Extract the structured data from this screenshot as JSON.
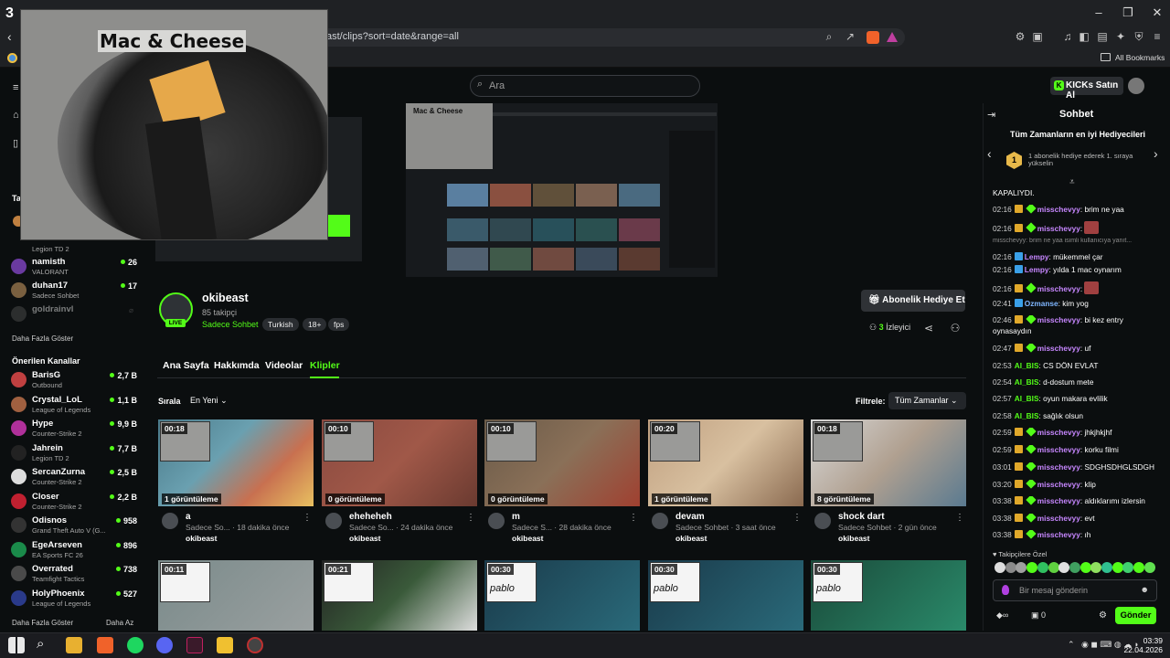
{
  "browser": {
    "url": "ast/clips?sort=date&range=all",
    "all_bookmarks": "All Bookmarks",
    "tab_number": "3"
  },
  "pip": {
    "title": "Mac & Cheese"
  },
  "header": {
    "search_placeholder": "Ara",
    "buy_kicks": "KICKs Satın Al"
  },
  "sidebar": {
    "partial_cat": "Legion TD 2",
    "channels": [
      {
        "name": "namisth",
        "category": "VALORANT",
        "viewers": "26"
      },
      {
        "name": "duhan17",
        "category": "Sadece Sohbet",
        "viewers": "17"
      },
      {
        "name": "goldrainvl",
        "category": "",
        "viewers": ""
      }
    ],
    "show_more_1": "Daha Fazla Göster",
    "recommended_title": "Önerilen Kanallar",
    "recommended": [
      {
        "name": "BarisG",
        "category": "Outbound",
        "viewers": "2,7 B"
      },
      {
        "name": "Crystal_LoL",
        "category": "League of Legends",
        "viewers": "1,1 B"
      },
      {
        "name": "Hype",
        "category": "Counter-Strike 2",
        "viewers": "9,9 B"
      },
      {
        "name": "Jahrein",
        "category": "Legion TD 2",
        "viewers": "7,7 B"
      },
      {
        "name": "SercanZurna",
        "category": "Counter-Strike 2",
        "viewers": "2,5 B"
      },
      {
        "name": "Closer",
        "category": "Counter-Strike 2",
        "viewers": "2,2 B"
      },
      {
        "name": "Odisnos",
        "category": "Grand Theft Auto V (G...",
        "viewers": "958"
      },
      {
        "name": "EgeArseven",
        "category": "EA Sports FC 26",
        "viewers": "896"
      },
      {
        "name": "Overrated",
        "category": "Teamfight Tactics",
        "viewers": "738"
      },
      {
        "name": "HolyPhoenix",
        "category": "League of Legends",
        "viewers": "527"
      }
    ],
    "show_more_2": "Daha Fazla Göster",
    "show_less": "Daha Az"
  },
  "channel": {
    "name": "okibeast",
    "followers": "85 takipçi",
    "category": "Sadece Sohbet",
    "tags": [
      "Turkish",
      "18+",
      "fps"
    ],
    "live": "LIVE",
    "gift_sub": "Abonelik Hediye Et",
    "viewer_count": "3",
    "viewer_label": "İzleyici"
  },
  "tabs": [
    "Ana Sayfa",
    "Hakkımda",
    "Videolar",
    "Klipler"
  ],
  "sort": {
    "label": "Sırala",
    "value": "En Yeni"
  },
  "filter": {
    "label": "Filtrele:",
    "value": "Tüm Zamanlar"
  },
  "clips": [
    {
      "duration": "00:18",
      "views": "1 görüntüleme",
      "title": "a",
      "meta": "Sadece So... · 18 dakika önce",
      "channel": "okibeast"
    },
    {
      "duration": "00:10",
      "views": "0 görüntüleme",
      "title": "eheheheh",
      "meta": "Sadece So... · 24 dakika önce",
      "channel": "okibeast"
    },
    {
      "duration": "00:10",
      "views": "0 görüntüleme",
      "title": "m",
      "meta": "Sadece S... · 28 dakika önce",
      "channel": "okibeast"
    },
    {
      "duration": "00:20",
      "views": "1 görüntüleme",
      "title": "devam",
      "meta": "Sadece Sohbet · 3 saat önce",
      "channel": "okibeast"
    },
    {
      "duration": "00:18",
      "views": "8 görüntüleme",
      "title": "shock dart",
      "meta": "Sadece Sohbet · 2 gün önce",
      "channel": "okibeast"
    }
  ],
  "clips_row2": [
    {
      "duration": "00:11",
      "caption": ""
    },
    {
      "duration": "00:21",
      "caption": ""
    },
    {
      "duration": "00:30",
      "caption": "pablo"
    },
    {
      "duration": "00:30",
      "caption": "pablo"
    },
    {
      "duration": "00:30",
      "caption": "pablo"
    }
  ],
  "chat": {
    "title": "Sohbet",
    "top_gifters": "Tüm Zamanların en iyi Hediyecileri",
    "gift_rank": "1",
    "gift_text": "1 abonelik hediye ederek 1. sıraya yükselin",
    "closed": "KAPALIYDI.",
    "reply_preview": "misschevyy: brim ne yaa isimli kullanıcıya yanıt...",
    "messages": [
      {
        "time": "02:16",
        "user": "misschevyy",
        "text": "brim ne yaa",
        "badges": "sub-gift",
        "color": "#c787ff"
      },
      {
        "time": "02:16",
        "user": "misschevyy",
        "text": "",
        "badges": "sub-gift",
        "color": "#c787ff",
        "emote": true
      },
      {
        "time": "02:16",
        "user": "Lempy",
        "text": "mükemmel çar",
        "badges": "blue",
        "color": "#c787ff"
      },
      {
        "time": "02:16",
        "user": "Lempy",
        "text": "yılda 1 mac oynarım",
        "badges": "blue",
        "color": "#c787ff"
      },
      {
        "time": "02:16",
        "user": "misschevyy",
        "text": "",
        "badges": "sub-gift",
        "color": "#c787ff",
        "emote": true
      },
      {
        "time": "02:41",
        "user": "Ozmanse",
        "text": "kim yog",
        "badges": "blue",
        "color": "#7fb6ff"
      },
      {
        "time": "02:46",
        "user": "misschevyy",
        "text": "bi kez entry",
        "badges": "sub-gift",
        "color": "#c787ff"
      },
      {
        "time": "02:47",
        "user": "misschevyy",
        "text": "uf",
        "badges": "sub-gift",
        "color": "#c787ff"
      },
      {
        "time": "02:53",
        "user": "AI_BIS",
        "text": "CS DÖN EVLAT",
        "badges": "",
        "color": "#53fc18"
      },
      {
        "time": "02:54",
        "user": "AI_BIS",
        "text": "d-dostum mete",
        "badges": "",
        "color": "#53fc18"
      },
      {
        "time": "02:57",
        "user": "AI_BIS",
        "text": "oyun makara evlilik",
        "badges": "",
        "color": "#53fc18"
      },
      {
        "time": "02:58",
        "user": "AI_BIS",
        "text": "sağlık olsun",
        "badges": "",
        "color": "#53fc18"
      },
      {
        "time": "02:59",
        "user": "misschevyy",
        "text": "jhkjhkjhf",
        "badges": "sub-gift",
        "color": "#c787ff"
      },
      {
        "time": "02:59",
        "user": "misschevyy",
        "text": "korku filmi",
        "badges": "sub-gift",
        "color": "#c787ff"
      },
      {
        "time": "03:01",
        "user": "misschevyy",
        "text": "SDGHSDHGLSDGH",
        "badges": "sub-gift",
        "color": "#c787ff"
      },
      {
        "time": "03:20",
        "user": "misschevyy",
        "text": "klip",
        "badges": "sub-gift",
        "color": "#c787ff"
      },
      {
        "time": "03:38",
        "user": "misschevyy",
        "text": "aldıklarımı izlersin",
        "badges": "sub-gift",
        "color": "#c787ff"
      },
      {
        "time": "03:38",
        "user": "misschevyy",
        "text": "evt",
        "badges": "sub-gift",
        "color": "#c787ff"
      },
      {
        "time": "03:38",
        "user": "misschevyy",
        "text": "ıh",
        "badges": "sub-gift",
        "color": "#c787ff"
      }
    ],
    "wrap_text": "oynasaydın",
    "followers_only": "Takipçilere Özel",
    "input_placeholder": "Bir mesaj gönderin",
    "kicks_count": "0",
    "send": "Gönder"
  },
  "taskbar": {
    "time": "03:39",
    "date": "22.04.2026"
  }
}
